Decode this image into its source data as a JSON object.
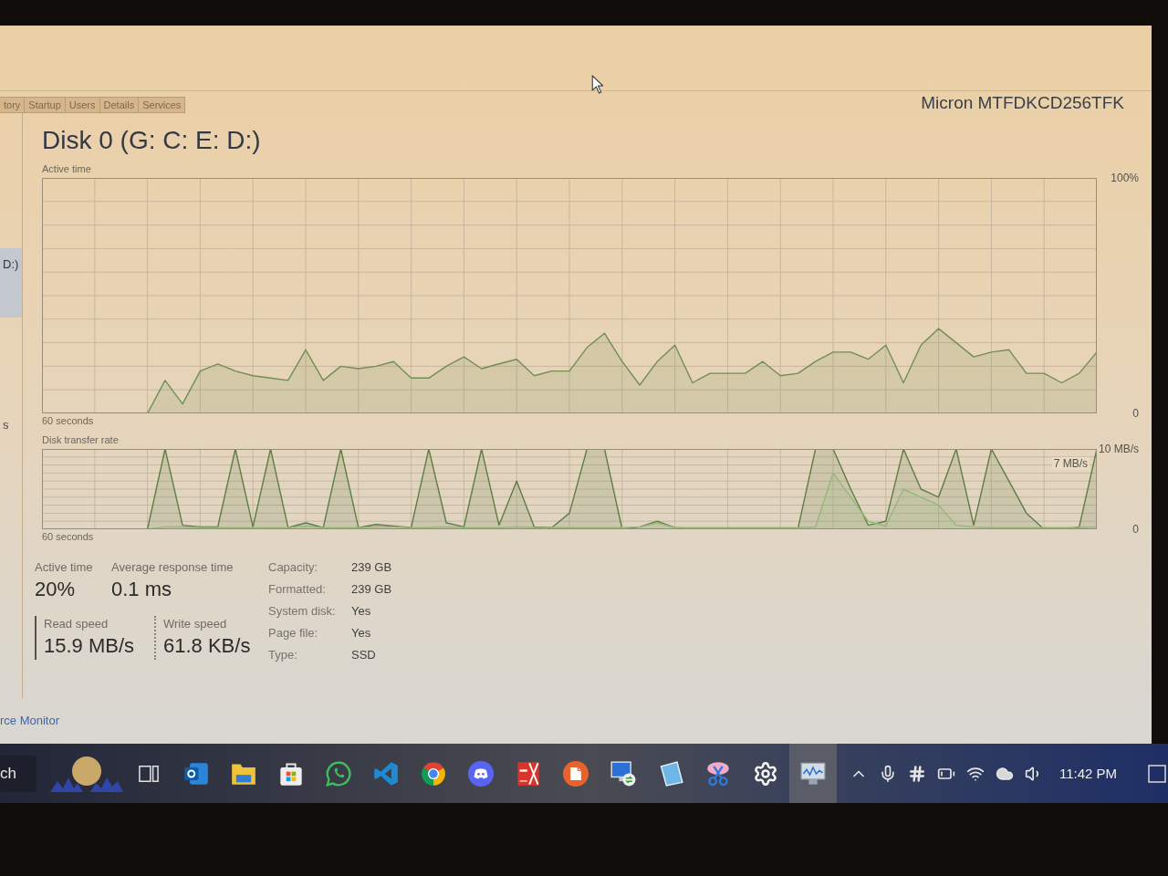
{
  "tabs": [
    {
      "label": "tory",
      "selected": false
    },
    {
      "label": "Startup",
      "selected": false
    },
    {
      "label": "Users",
      "selected": false
    },
    {
      "label": "Details",
      "selected": false
    },
    {
      "label": "Services",
      "selected": false
    }
  ],
  "sidebar": {
    "items": [
      {
        "label": "D:)",
        "selected": true
      },
      {
        "label": "s",
        "selected": false
      }
    ]
  },
  "header": {
    "title": "Disk 0 (G: C: E: D:)",
    "model": "Micron MTFDKCD256TFK"
  },
  "active_time_chart": {
    "chart_data": {
      "type": "area",
      "title": "Active time",
      "xlabel": "60 seconds",
      "ylim": [
        0,
        100
      ],
      "yticks": [
        {
          "value": 0,
          "label": "0"
        },
        {
          "value": 100,
          "label": "100%"
        }
      ],
      "grid": true,
      "series": [
        {
          "color": "#6f8f55",
          "values": [
            0,
            0,
            0,
            0,
            0,
            0,
            0,
            14,
            4,
            18,
            21,
            18,
            16,
            15,
            14,
            27,
            14,
            20,
            19,
            20,
            22,
            15,
            15,
            20,
            24,
            19,
            21,
            23,
            16,
            18,
            18,
            28,
            34,
            22,
            12,
            22,
            29,
            13,
            17,
            17,
            17,
            22,
            16,
            17,
            22,
            26,
            26,
            23,
            29,
            13,
            29,
            36,
            30,
            24,
            26,
            27,
            17,
            17,
            13,
            17,
            26
          ]
        }
      ]
    }
  },
  "transfer_rate_chart": {
    "chart_data": {
      "type": "area",
      "title": "Disk transfer rate",
      "xlabel": "60 seconds",
      "ylim": [
        0,
        10
      ],
      "yticks": [
        {
          "value": 0,
          "label": "0"
        },
        {
          "value": 10,
          "label": "10 MB/s"
        }
      ],
      "grid": true,
      "annotations": [
        "7 MB/s"
      ],
      "series": [
        {
          "color": "#5e7d45",
          "values": [
            0,
            0,
            0,
            0,
            0,
            0,
            0,
            10,
            0.5,
            0.3,
            0.3,
            10,
            0.3,
            10,
            0.2,
            0.8,
            0.2,
            10,
            0.2,
            0.6,
            0.4,
            0.2,
            10,
            0.8,
            0.3,
            10,
            0.5,
            6,
            0.3,
            0.2,
            2,
            10,
            10,
            0,
            0.3,
            1,
            0.2,
            0.1,
            0.1,
            0.1,
            0.1,
            0.1,
            0.1,
            0.1,
            10,
            10,
            5,
            0.5,
            1,
            10,
            5,
            4,
            10,
            0.5,
            10,
            6,
            2,
            0,
            0,
            0.3,
            10
          ]
        },
        {
          "color": "#93b978",
          "values": [
            0,
            0,
            0,
            0,
            0,
            0,
            0,
            0.3,
            0.3,
            0.2,
            0.2,
            0.2,
            0.2,
            0.2,
            0.2,
            0.4,
            0.2,
            0.2,
            0.2,
            0.3,
            0.3,
            0.2,
            0.2,
            0.3,
            0.2,
            0.2,
            0.2,
            0.3,
            0.2,
            0.2,
            0.2,
            0.2,
            0.2,
            0.2,
            0.3,
            0.8,
            0.2,
            0.2,
            0.2,
            0.2,
            0.2,
            0.2,
            0.2,
            0.2,
            0.3,
            7,
            4,
            1,
            0.4,
            5,
            4,
            3,
            0.5,
            0.3,
            0.2,
            0.2,
            0.2,
            0.2,
            0.2,
            0.2,
            0.3
          ]
        }
      ]
    }
  },
  "stats": [
    {
      "label": "Active time",
      "value": "20%",
      "kind": "plain"
    },
    {
      "label": "Average response time",
      "value": "0.1 ms",
      "kind": "plain"
    },
    {
      "label": "Read speed",
      "value": "15.9 MB/s",
      "kind": "solid"
    },
    {
      "label": "Write speed",
      "value": "61.8 KB/s",
      "kind": "dotted"
    }
  ],
  "properties": [
    {
      "label": "Capacity:",
      "value": "239 GB"
    },
    {
      "label": "Formatted:",
      "value": "239 GB"
    },
    {
      "label": "System disk:",
      "value": "Yes"
    },
    {
      "label": "Page file:",
      "value": "Yes"
    },
    {
      "label": "Type:",
      "value": "SSD"
    }
  ],
  "footer": {
    "link": "rce Monitor"
  },
  "taskbar": {
    "search": "ch",
    "apps": [
      {
        "kind": "taskview",
        "selected": false
      },
      {
        "kind": "mail",
        "selected": false
      },
      {
        "kind": "folder",
        "selected": false
      },
      {
        "kind": "store",
        "selected": false
      },
      {
        "kind": "chat",
        "selected": false
      },
      {
        "kind": "code",
        "selected": false
      },
      {
        "kind": "browser",
        "selected": false
      },
      {
        "kind": "voice",
        "selected": false
      },
      {
        "kind": "pdf",
        "selected": false
      },
      {
        "kind": "office",
        "selected": false
      },
      {
        "kind": "remote",
        "selected": false
      },
      {
        "kind": "tablet",
        "selected": false
      },
      {
        "kind": "snip",
        "selected": false
      },
      {
        "kind": "settings",
        "selected": false
      },
      {
        "kind": "monitor",
        "selected": true
      }
    ],
    "clock": "11:42 PM"
  }
}
